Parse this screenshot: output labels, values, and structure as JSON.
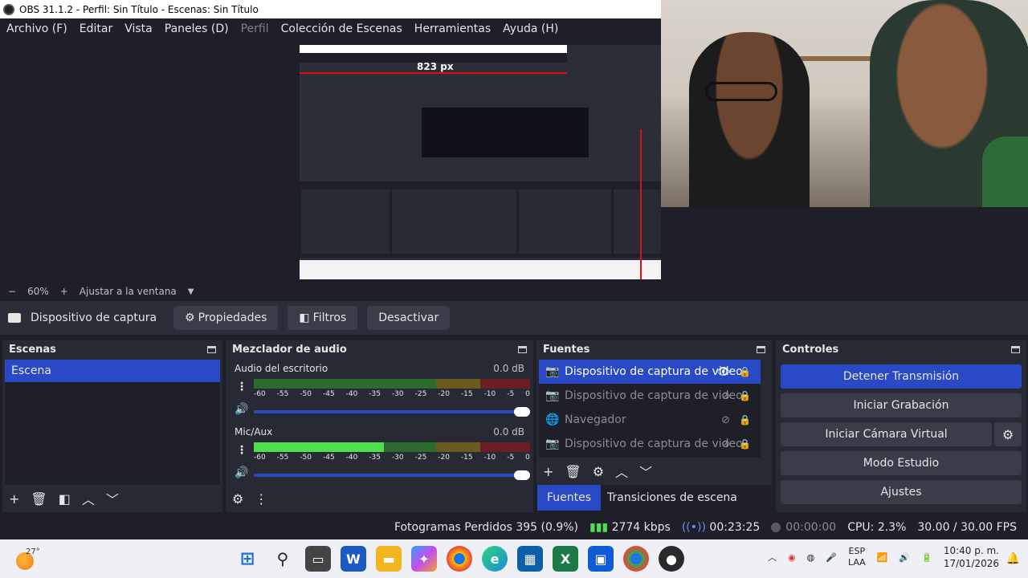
{
  "window": {
    "title": "OBS 31.1.2 - Perfil: Sin Título - Escenas: Sin Título"
  },
  "menu": {
    "items": [
      "Archivo (F)",
      "Editar",
      "Vista",
      "Paneles (D)",
      "Perfil",
      "Colección de Escenas",
      "Herramientas",
      "Ayuda (H)"
    ]
  },
  "preview": {
    "overlay_label": "823 px"
  },
  "zoom": {
    "minus": "−",
    "value": "60%",
    "plus": "+",
    "fit_label": "Ajustar a la ventana"
  },
  "source_toolbar": {
    "source_name": "Dispositivo de captura de v",
    "properties": "Propiedades",
    "filters": "Filtros",
    "deactivate": "Desactivar"
  },
  "scenes": {
    "title": "Escenas",
    "items": [
      "Escena"
    ]
  },
  "mixer": {
    "title": "Mezclador de audio",
    "scale": [
      "-60",
      "-55",
      "-50",
      "-45",
      "-40",
      "-35",
      "-30",
      "-25",
      "-20",
      "-15",
      "-10",
      "-5",
      "0"
    ],
    "channels": [
      {
        "name": "Audio del escritorio",
        "db": "0.0 dB",
        "level": 0
      },
      {
        "name": "Mic/Aux",
        "db": "0.0 dB",
        "level": 0.47
      }
    ]
  },
  "sources": {
    "title": "Fuentes",
    "items": [
      {
        "name": "Dispositivo de captura de video",
        "icon": "camera-icon",
        "visible": true
      },
      {
        "name": "Dispositivo de captura de video",
        "icon": "camera-icon",
        "visible": false
      },
      {
        "name": "Navegador",
        "icon": "globe-icon",
        "visible": false
      },
      {
        "name": "Dispositivo de captura de video",
        "icon": "camera-icon",
        "visible": false
      }
    ],
    "tabs": [
      "Fuentes",
      "Transiciones de escena"
    ]
  },
  "controls": {
    "title": "Controles",
    "stop_stream": "Detener Transmisión",
    "start_recording": "Iniciar Grabación",
    "start_virtual_cam": "Iniciar Cámara Virtual",
    "studio_mode": "Modo Estudio",
    "settings": "Ajustes"
  },
  "status": {
    "dropped_frames": "Fotogramas Perdidos 395 (0.9%)",
    "bitrate": "2774 kbps",
    "stream_time": "00:23:25",
    "rec_time": "00:00:00",
    "cpu": "CPU: 2.3%",
    "fps": "30.00 / 30.00 FPS"
  },
  "taskbar": {
    "temperature": "27°",
    "lang_top": "ESP",
    "lang_bottom": "LAA",
    "time": "10:40 p. m.",
    "date": "17/01/2026"
  },
  "colors": {
    "accent": "#2a49c5",
    "panel": "#272935",
    "background": "#1e1f29"
  }
}
